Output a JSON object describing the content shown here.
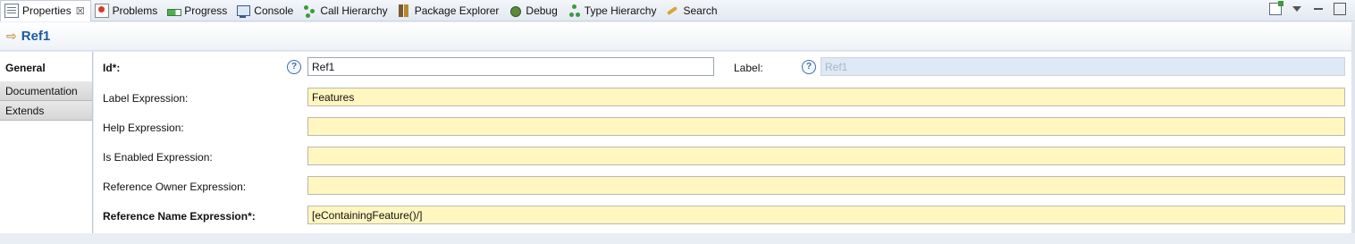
{
  "tabs": [
    {
      "label": "Properties",
      "icon": "properties-icon",
      "active": true
    },
    {
      "label": "Problems",
      "icon": "problems-icon"
    },
    {
      "label": "Progress",
      "icon": "progress-icon"
    },
    {
      "label": "Console",
      "icon": "console-icon"
    },
    {
      "label": "Call Hierarchy",
      "icon": "call-hierarchy-icon"
    },
    {
      "label": "Package Explorer",
      "icon": "package-explorer-icon"
    },
    {
      "label": "Debug",
      "icon": "debug-icon"
    },
    {
      "label": "Type Hierarchy",
      "icon": "type-hierarchy-icon"
    },
    {
      "label": "Search",
      "icon": "search-icon"
    }
  ],
  "close_glyph": "☒",
  "header": {
    "title": "Ref1",
    "arrow": "⇨"
  },
  "side_tabs": [
    "General",
    "Documentation",
    "Extends"
  ],
  "help_glyph": "?",
  "form": {
    "id_label": "Id*:",
    "id_value": "Ref1",
    "label_label": "Label:",
    "label_value": "Ref1",
    "label_expression_label": "Label Expression:",
    "label_expression_value": "Features",
    "help_expression_label": "Help Expression:",
    "help_expression_value": "",
    "is_enabled_label": "Is Enabled Expression:",
    "is_enabled_value": "",
    "reference_owner_label": "Reference Owner Expression:",
    "reference_owner_value": "",
    "reference_name_label": "Reference Name Expression*:",
    "reference_name_value": "[eContainingFeature()/]"
  },
  "colors": {
    "expression_field_bg": "#fff6c0",
    "title_color": "#1c5aa5"
  }
}
